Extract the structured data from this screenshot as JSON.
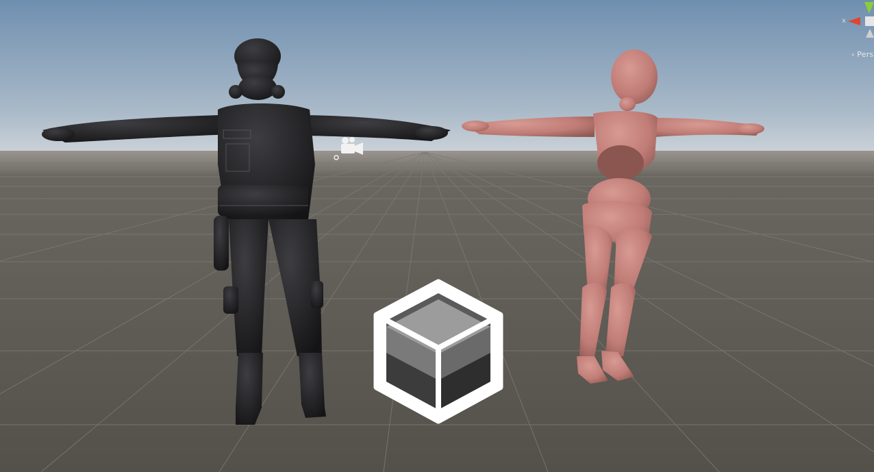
{
  "viewport": {
    "type": "scene-view",
    "background_colors": {
      "sky_top": "#6f8fb0",
      "sky_horizon": "#c6ced6",
      "ground": "#5b5751",
      "grid_line": "#7a766f"
    }
  },
  "gizmo": {
    "axis_x_label": "x",
    "projection_label": "‹ Pers"
  },
  "objects": [
    {
      "name": "swat-character",
      "color": "#262628"
    },
    {
      "name": "mannequin-character",
      "color": "#c07c76"
    },
    {
      "name": "camera-gizmo",
      "icon": "camera-icon"
    },
    {
      "name": "prefab-cube-icon",
      "icon": "cube-icon"
    }
  ]
}
